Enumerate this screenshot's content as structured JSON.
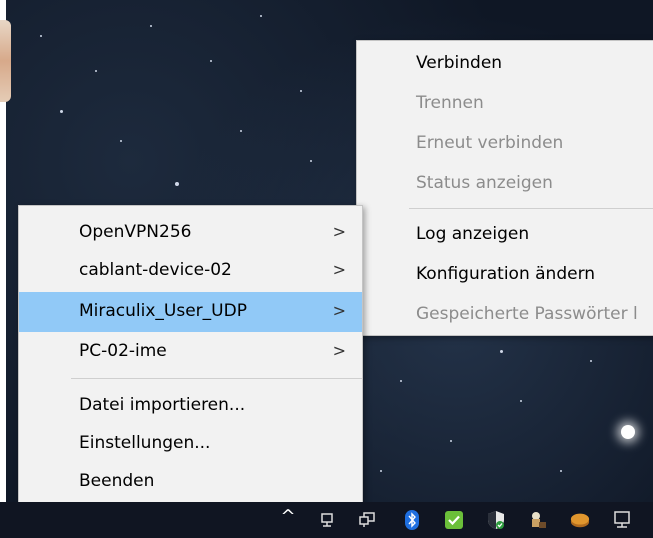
{
  "submenu": {
    "items": [
      {
        "label": "Verbinden",
        "enabled": true
      },
      {
        "label": "Trennen",
        "enabled": false
      },
      {
        "label": "Erneut verbinden",
        "enabled": false
      },
      {
        "label": "Status anzeigen",
        "enabled": false
      },
      {
        "label": "Log anzeigen",
        "enabled": true
      },
      {
        "label": "Konfiguration ändern",
        "enabled": true
      },
      {
        "label": "Gespeicherte Passwörter l",
        "enabled": false
      }
    ]
  },
  "main_menu": {
    "connections": [
      {
        "label": "OpenVPN256",
        "arrow": ">"
      },
      {
        "label": "cablant-device-02",
        "arrow": ">"
      },
      {
        "label": "Miraculix_User_UDP",
        "arrow": ">",
        "highlighted": true
      },
      {
        "label": "PC-02-ime",
        "arrow": ">"
      }
    ],
    "actions": [
      {
        "label": "Datei importieren..."
      },
      {
        "label": "Einstellungen..."
      },
      {
        "label": "Beenden"
      }
    ]
  },
  "taskbar": {
    "chevron": "^",
    "icons": [
      "show-hidden-icons-chevron",
      "network-monitor-icon",
      "network-icon",
      "bluetooth-icon",
      "defender-check-icon",
      "security-shield-icon",
      "puzzle-app-icon",
      "disk-app-icon",
      "display-icon"
    ]
  },
  "colors": {
    "highlight": "#91c9f7",
    "menu_bg": "#f2f2f2",
    "disabled_text": "#8c8c8c"
  }
}
